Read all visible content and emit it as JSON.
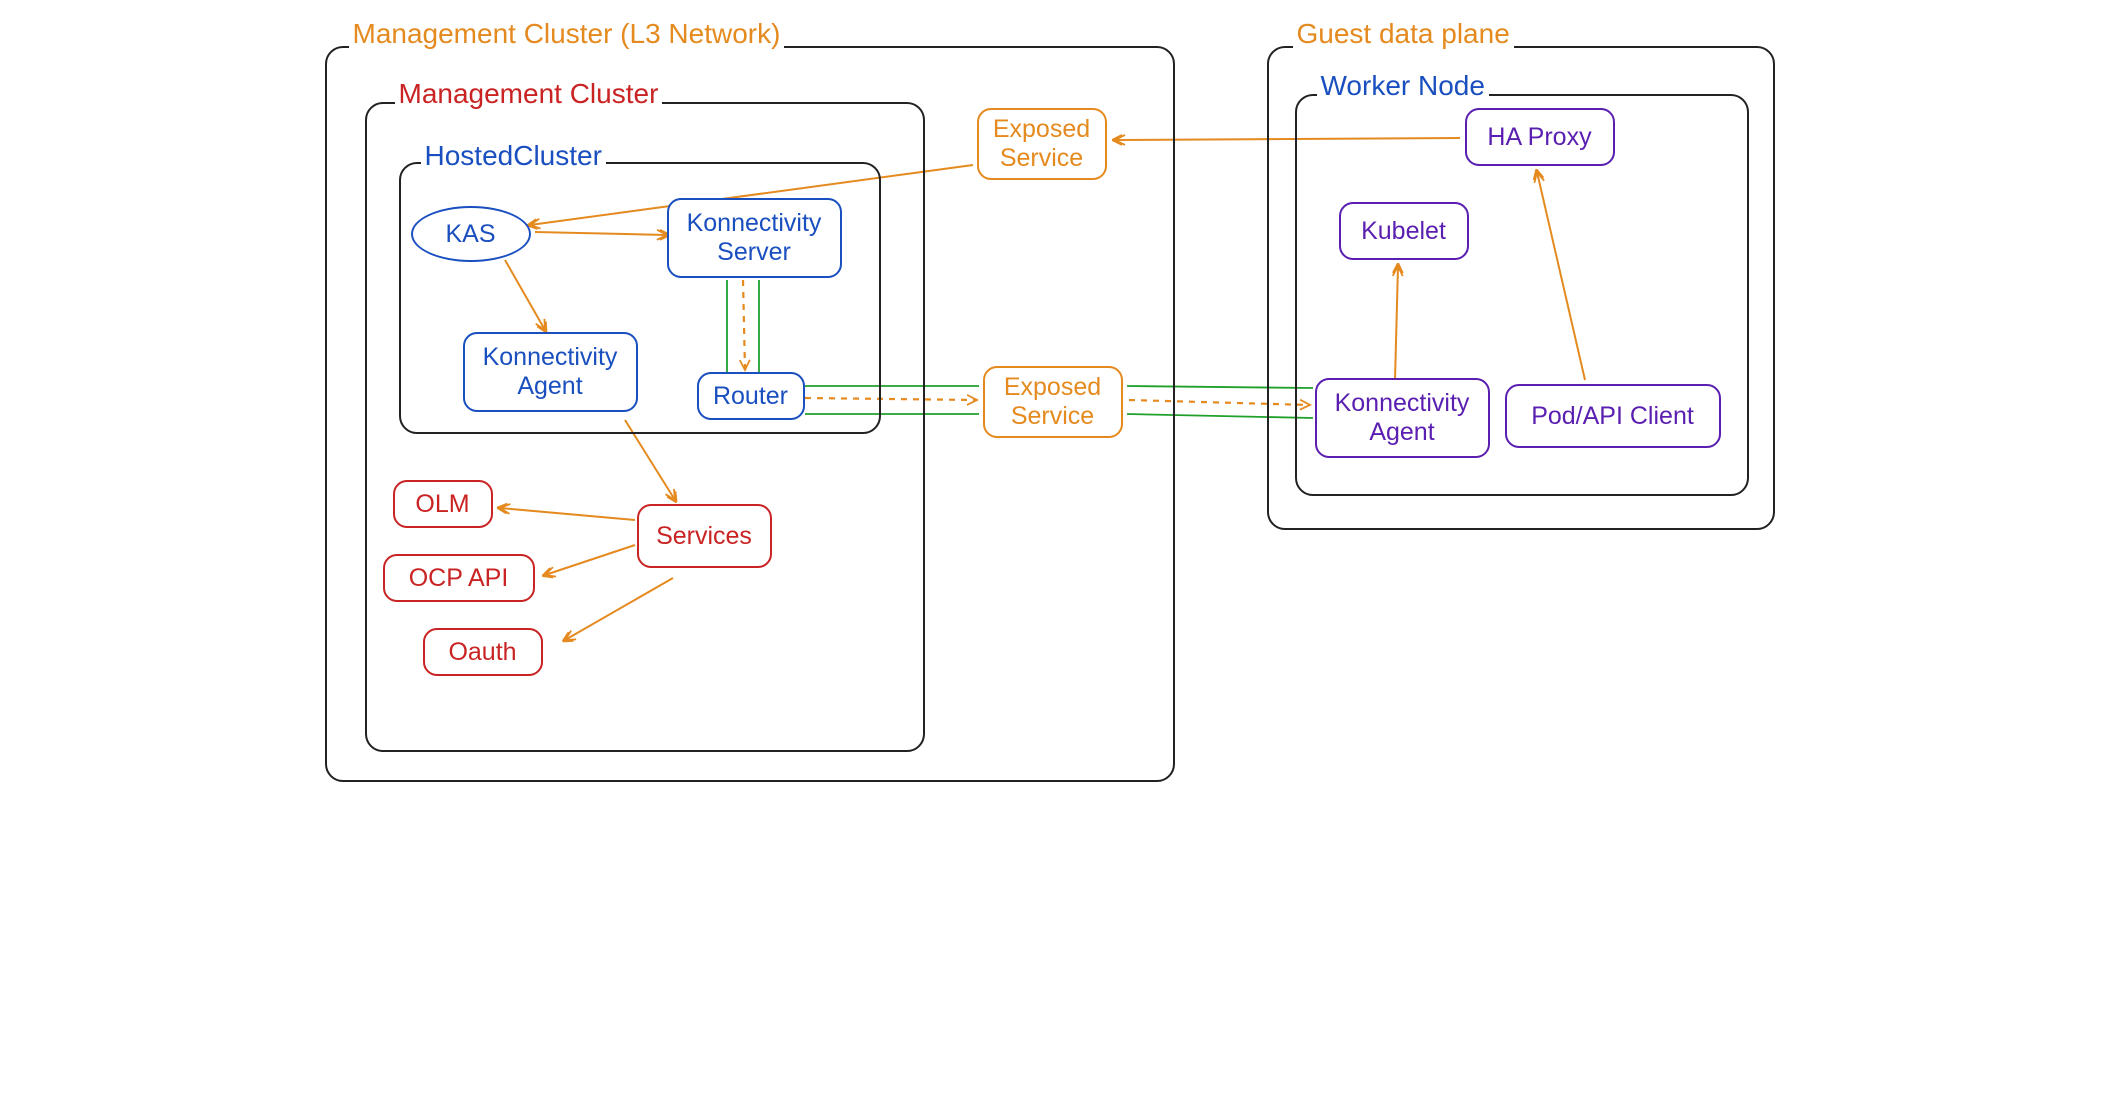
{
  "colors": {
    "orange": "#e48a1f",
    "red": "#c92323",
    "blue": "#1a4fbf",
    "purple": "#5a1fb0",
    "green": "#1fa02a",
    "black": "#222"
  },
  "containers": {
    "mgmt_l3": "Management Cluster (L3 Network)",
    "mgmt_cluster": "Management Cluster",
    "hosted_cluster": "HostedCluster",
    "guest_dp": "Guest data plane",
    "worker_node": "Worker Node"
  },
  "mgmt": {
    "kas": "KAS",
    "konn_server": "Konnectivity Server",
    "konn_agent_mgmt": "Konnectivity Agent",
    "router": "Router",
    "services": "Services",
    "olm": "OLM",
    "ocp_api": "OCP API",
    "oauth": "Oauth"
  },
  "exposed": {
    "top": "Exposed Service",
    "mid": "Exposed Service"
  },
  "guest": {
    "ha_proxy": "HA Proxy",
    "kubelet": "Kubelet",
    "konn_agent_guest": "Konnectivity Agent",
    "pod_api_client": "Pod/API Client"
  }
}
